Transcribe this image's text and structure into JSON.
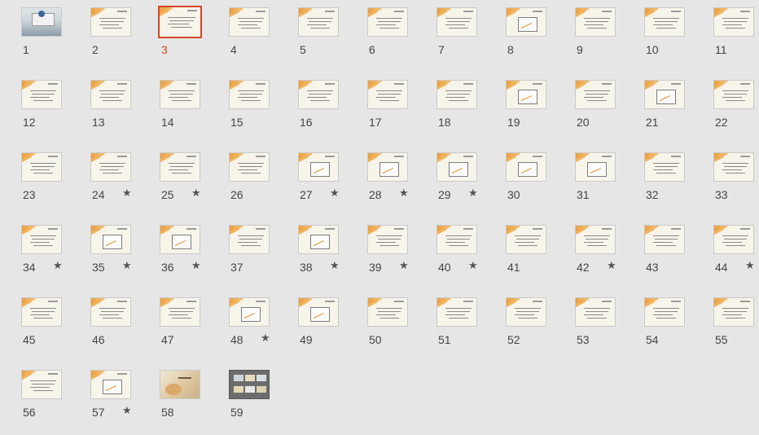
{
  "selected_slide": "3",
  "star_glyph": "★",
  "slides": [
    {
      "num": "1",
      "style": "photo",
      "star": false
    },
    {
      "num": "2",
      "style": "text",
      "star": false
    },
    {
      "num": "3",
      "style": "text",
      "star": false
    },
    {
      "num": "4",
      "style": "text",
      "star": false
    },
    {
      "num": "5",
      "style": "text",
      "star": false
    },
    {
      "num": "6",
      "style": "text",
      "star": false
    },
    {
      "num": "7",
      "style": "text",
      "star": false
    },
    {
      "num": "8",
      "style": "figure",
      "star": false
    },
    {
      "num": "9",
      "style": "text",
      "star": false
    },
    {
      "num": "10",
      "style": "text",
      "star": false
    },
    {
      "num": "11",
      "style": "text",
      "star": false
    },
    {
      "num": "12",
      "style": "text",
      "star": false
    },
    {
      "num": "13",
      "style": "text",
      "star": false
    },
    {
      "num": "14",
      "style": "text",
      "star": false
    },
    {
      "num": "15",
      "style": "text",
      "star": false
    },
    {
      "num": "16",
      "style": "text",
      "star": false
    },
    {
      "num": "17",
      "style": "text",
      "star": false
    },
    {
      "num": "18",
      "style": "text",
      "star": false
    },
    {
      "num": "19",
      "style": "figure",
      "star": false
    },
    {
      "num": "20",
      "style": "text",
      "star": false
    },
    {
      "num": "21",
      "style": "figure",
      "star": false
    },
    {
      "num": "22",
      "style": "text",
      "star": false
    },
    {
      "num": "23",
      "style": "text",
      "star": false
    },
    {
      "num": "24",
      "style": "text",
      "star": true
    },
    {
      "num": "25",
      "style": "text",
      "star": true
    },
    {
      "num": "26",
      "style": "text",
      "star": false
    },
    {
      "num": "27",
      "style": "figure",
      "star": true
    },
    {
      "num": "28",
      "style": "figure",
      "star": true
    },
    {
      "num": "29",
      "style": "figure",
      "star": true
    },
    {
      "num": "30",
      "style": "figure",
      "star": false
    },
    {
      "num": "31",
      "style": "figure",
      "star": false
    },
    {
      "num": "32",
      "style": "text",
      "star": false
    },
    {
      "num": "33",
      "style": "text",
      "star": false
    },
    {
      "num": "34",
      "style": "text",
      "star": true
    },
    {
      "num": "35",
      "style": "figure",
      "star": true
    },
    {
      "num": "36",
      "style": "figure",
      "star": true
    },
    {
      "num": "37",
      "style": "text",
      "star": false
    },
    {
      "num": "38",
      "style": "figure",
      "star": true
    },
    {
      "num": "39",
      "style": "text",
      "star": true
    },
    {
      "num": "40",
      "style": "text",
      "star": true
    },
    {
      "num": "41",
      "style": "text",
      "star": false
    },
    {
      "num": "42",
      "style": "text",
      "star": true
    },
    {
      "num": "43",
      "style": "text",
      "star": false
    },
    {
      "num": "44",
      "style": "text",
      "star": true
    },
    {
      "num": "45",
      "style": "text",
      "star": false
    },
    {
      "num": "46",
      "style": "text",
      "star": false
    },
    {
      "num": "47",
      "style": "text",
      "star": false
    },
    {
      "num": "48",
      "style": "figure",
      "star": true
    },
    {
      "num": "49",
      "style": "figure",
      "star": false
    },
    {
      "num": "50",
      "style": "text",
      "star": false
    },
    {
      "num": "51",
      "style": "text",
      "star": false
    },
    {
      "num": "52",
      "style": "text",
      "star": false
    },
    {
      "num": "53",
      "style": "text",
      "star": false
    },
    {
      "num": "54",
      "style": "text",
      "star": false
    },
    {
      "num": "55",
      "style": "text",
      "star": false
    },
    {
      "num": "56",
      "style": "text",
      "star": false
    },
    {
      "num": "57",
      "style": "figure",
      "star": true
    },
    {
      "num": "58",
      "style": "warm",
      "star": false
    },
    {
      "num": "59",
      "style": "dark",
      "star": false
    }
  ]
}
